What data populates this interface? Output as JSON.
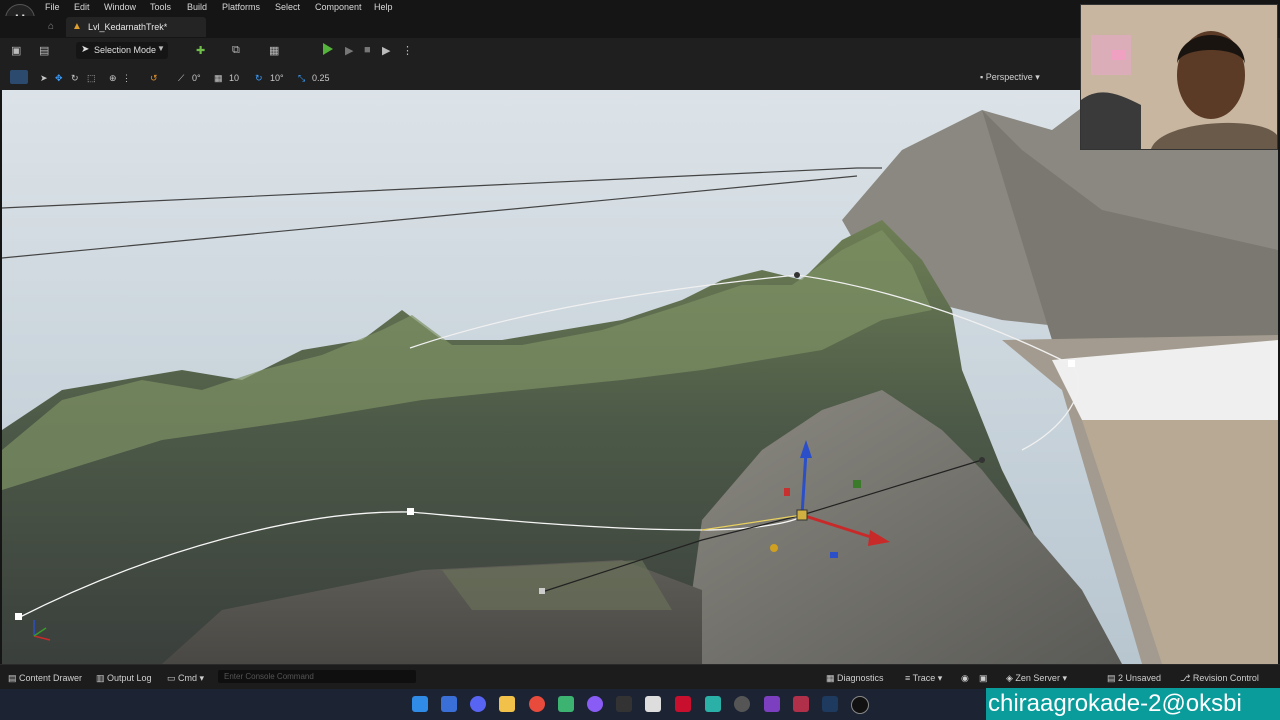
{
  "menu": {
    "file": "File",
    "edit": "Edit",
    "window": "Window",
    "tools": "Tools",
    "build": "Build",
    "platforms": "Platforms",
    "select": "Select",
    "component": "Component",
    "help": "Help"
  },
  "tab": {
    "level_name": "Lvl_KedarnathTrek*"
  },
  "toolbar": {
    "selection_mode": "Selection Mode"
  },
  "viewport_toolbar": {
    "rotation_value": "0°",
    "grid_snap": "10",
    "rotation_snap": "10°",
    "scale_snap": "0.25",
    "view_mode": "Perspective"
  },
  "statusbar": {
    "content_drawer": "Content Drawer",
    "output_log": "Output Log",
    "cmd": "Cmd",
    "console_placeholder": "Enter Console Command",
    "diagnostics": "Diagnostics",
    "trace": "Trace",
    "zen_server": "Zen Server",
    "unsaved": "2 Unsaved",
    "revision_control": "Revision Control"
  },
  "overlay": {
    "watermark": "chiraagrokade-2@oksbi"
  },
  "colors": {
    "play_green": "#54b33a",
    "sky": "#c9d4dc",
    "watermark_bg": "#0a9b9b",
    "taskbar": "#1c2333"
  }
}
